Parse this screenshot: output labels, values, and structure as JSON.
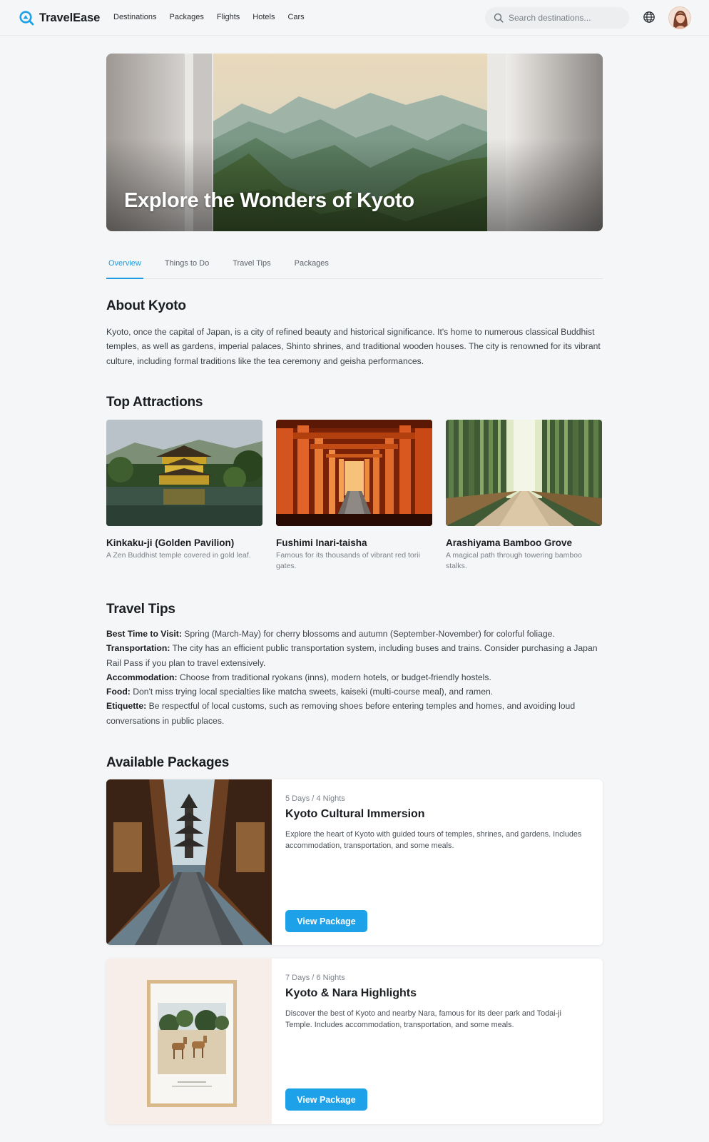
{
  "brand": {
    "name": "TravelEase",
    "accent": "#1da1e8"
  },
  "nav": {
    "links": [
      "Destinations",
      "Packages",
      "Flights",
      "Hotels",
      "Cars"
    ],
    "search_placeholder": "Search destinations..."
  },
  "hero": {
    "title": "Explore the Wonders of Kyoto"
  },
  "tabs": [
    {
      "label": "Overview",
      "active": true
    },
    {
      "label": "Things to Do",
      "active": false
    },
    {
      "label": "Travel Tips",
      "active": false
    },
    {
      "label": "Packages",
      "active": false
    }
  ],
  "about": {
    "heading": "About Kyoto",
    "text": "Kyoto, once the capital of Japan, is a city of refined beauty and historical significance. It's home to numerous classical Buddhist temples, as well as gardens, imperial palaces, Shinto shrines, and traditional wooden houses. The city is renowned for its vibrant culture, including formal traditions like the tea ceremony and geisha performances."
  },
  "attractions": {
    "heading": "Top Attractions",
    "items": [
      {
        "name": "Kinkaku-ji (Golden Pavilion)",
        "desc": "A Zen Buddhist temple covered in gold leaf."
      },
      {
        "name": "Fushimi Inari-taisha",
        "desc": "Famous for its thousands of vibrant red torii gates."
      },
      {
        "name": "Arashiyama Bamboo Grove",
        "desc": "A magical path through towering bamboo stalks."
      }
    ]
  },
  "tips": {
    "heading": "Travel Tips",
    "items": [
      {
        "label": "Best Time to Visit:",
        "text": " Spring (March-May) for cherry blossoms and autumn (September-November) for colorful foliage."
      },
      {
        "label": "Transportation:",
        "text": " The city has an efficient public transportation system, including buses and trains. Consider purchasing a Japan Rail Pass if you plan to travel extensively."
      },
      {
        "label": "Accommodation:",
        "text": " Choose from traditional ryokans (inns), modern hotels, or budget-friendly hostels."
      },
      {
        "label": "Food:",
        "text": " Don't miss trying local specialties like matcha sweets, kaiseki (multi-course meal), and ramen."
      },
      {
        "label": "Etiquette:",
        "text": " Be respectful of local customs, such as removing shoes before entering temples and homes, and avoiding loud conversations in public places."
      }
    ]
  },
  "packages": {
    "heading": "Available Packages",
    "items": [
      {
        "duration": "5 Days / 4 Nights",
        "title": "Kyoto Cultural Immersion",
        "desc": "Explore the heart of Kyoto with guided tours of temples, shrines, and gardens. Includes accommodation, transportation, and some meals.",
        "button": "View Package"
      },
      {
        "duration": "7 Days / 6 Nights",
        "title": "Kyoto & Nara Highlights",
        "desc": "Discover the best of Kyoto and nearby Nara, famous for its deer park and Todai-ji Temple. Includes accommodation, transportation, and some meals.",
        "button": "View Package"
      }
    ]
  }
}
